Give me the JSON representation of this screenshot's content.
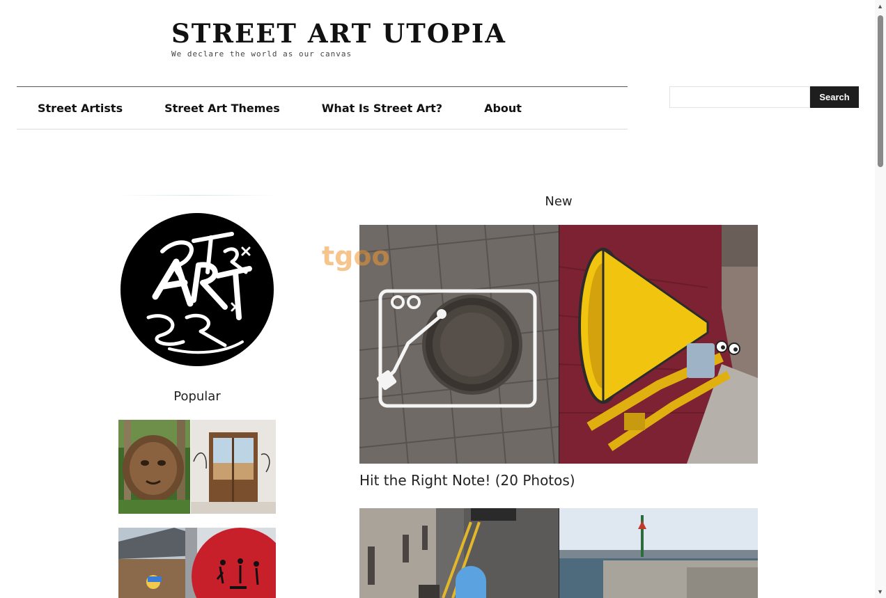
{
  "site": {
    "title": "STREET ART UTOPIA",
    "tagline": "We declare the world as our canvas"
  },
  "nav": {
    "items": [
      "Street Artists",
      "Street Art Themes",
      "What Is Street Art?",
      "About"
    ]
  },
  "search": {
    "placeholder": "",
    "button_label": "Search"
  },
  "sidebar": {
    "popular_title": "Popular"
  },
  "main": {
    "new_title": "New",
    "watermark": "tgoo",
    "posts": [
      {
        "title": "Hit the Right Note! (20 Photos)"
      }
    ]
  },
  "colors": {
    "header_text": "#111111",
    "search_button_bg": "#1e1e1e",
    "brick_wall": "#7d2232",
    "trumpet_yellow": "#f1c40f"
  }
}
